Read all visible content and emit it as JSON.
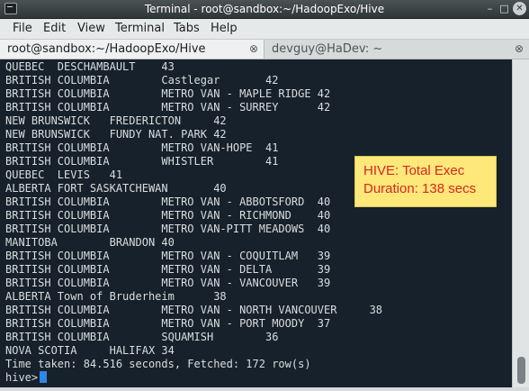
{
  "window": {
    "title": "Terminal - root@sandbox:~/HadoopExo/Hive",
    "minimize_glyph": "–",
    "maximize_glyph": "□",
    "close_glyph": "✕"
  },
  "menu": {
    "items": [
      "File",
      "Edit",
      "View",
      "Terminal",
      "Tabs",
      "Help"
    ]
  },
  "tabs": [
    {
      "label": "root@sandbox:~/HadoopExo/Hive",
      "active": true,
      "close_glyph": "⊗"
    },
    {
      "label": "devguy@HaDev: ~",
      "active": false,
      "close_glyph": "⊗"
    }
  ],
  "terminal": {
    "lines": [
      "QUEBEC  DESCHAMBAULT    43",
      "BRITISH COLUMBIA        Castlegar       42",
      "BRITISH COLUMBIA        METRO VAN - MAPLE RIDGE 42",
      "BRITISH COLUMBIA        METRO VAN - SURREY      42",
      "NEW BRUNSWICK   FREDERICTON     42",
      "NEW BRUNSWICK   FUNDY NAT. PARK 42",
      "BRITISH COLUMBIA        METRO VAN-HOPE  41",
      "BRITISH COLUMBIA        WHISTLER        41",
      "QUEBEC  LEVIS   41",
      "ALBERTA FORT SASKATCHEWAN       40",
      "BRITISH COLUMBIA        METRO VAN - ABBOTSFORD  40",
      "BRITISH COLUMBIA        METRO VAN - RICHMOND    40",
      "BRITISH COLUMBIA        METRO VAN-PITT MEADOWS  40",
      "MANITOBA        BRANDON 40",
      "BRITISH COLUMBIA        METRO VAN - COQUITLAM   39",
      "BRITISH COLUMBIA        METRO VAN - DELTA       39",
      "BRITISH COLUMBIA        METRO VAN - VANCOUVER   39",
      "ALBERTA Town of Bruderheim      38",
      "BRITISH COLUMBIA        METRO VAN - NORTH VANCOUVER     38",
      "BRITISH COLUMBIA        METRO VAN - PORT MOODY  37",
      "BRITISH COLUMBIA        SQUAMISH        36",
      "NOVA SCOTIA     HALIFAX 34",
      "Time taken: 84.516 seconds, Fetched: 172 row(s)"
    ],
    "prompt": "hive>"
  },
  "annotation": {
    "line1": "HIVE: Total Exec",
    "line2": "Duration: 138 secs"
  },
  "colors": {
    "terminal_bg": "#17212b",
    "terminal_fg": "#d9dde0",
    "cursor": "#2e86e6",
    "annotation_bg": "#ffe87a",
    "annotation_text": "#d8261f"
  }
}
